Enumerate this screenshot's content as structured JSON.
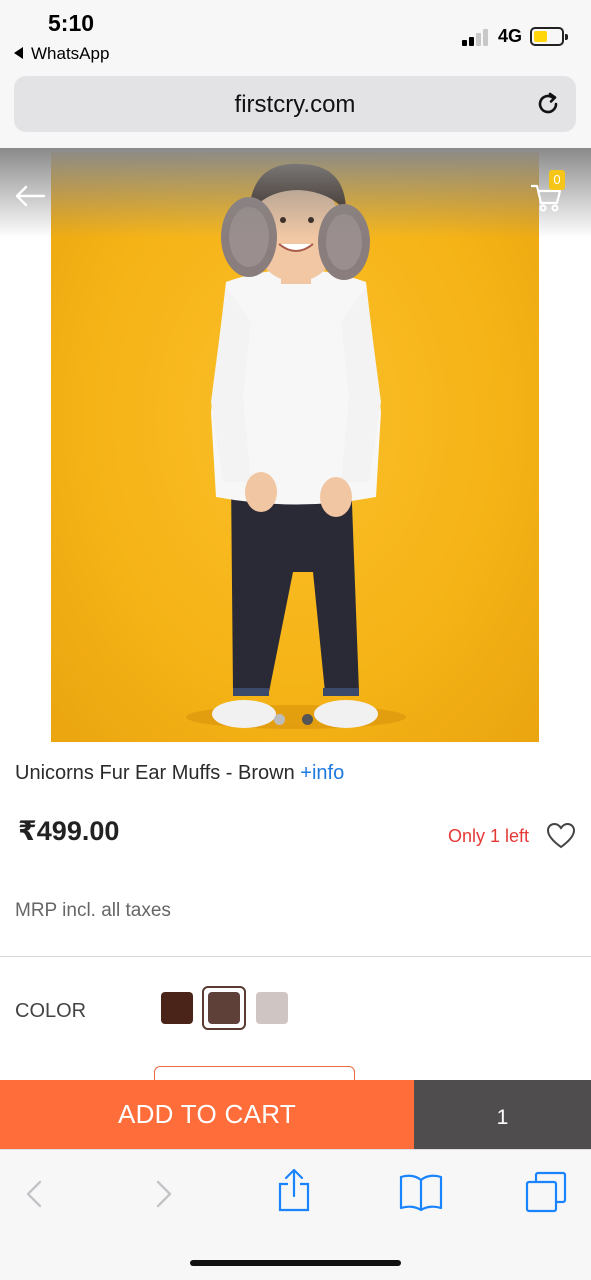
{
  "status_bar": {
    "time": "5:10",
    "back_app": "WhatsApp",
    "network": "4G"
  },
  "browser": {
    "url": "firstcry.com"
  },
  "header": {
    "cart_count": "0"
  },
  "product": {
    "name": "Unicorns Fur Ear Muffs - Brown",
    "info_link": "+info",
    "price": "₹499.00",
    "stock": "Only 1 left",
    "mrp_note": "MRP incl. all taxes",
    "color_label": "COLOR",
    "colors": [
      "#4a2418",
      "#5e4039",
      "#cfc6c4"
    ],
    "selected_color_index": 1,
    "image_count": 2,
    "active_image_index": 1
  },
  "actions": {
    "add_to_cart": "ADD TO CART",
    "quantity": "1"
  },
  "colors": {
    "accent": "#ff6d3b",
    "qty_bg": "#4f4d4e",
    "link": "#1f7ae0",
    "stock_red": "#e53935",
    "safari_blue": "#1a84ff"
  }
}
